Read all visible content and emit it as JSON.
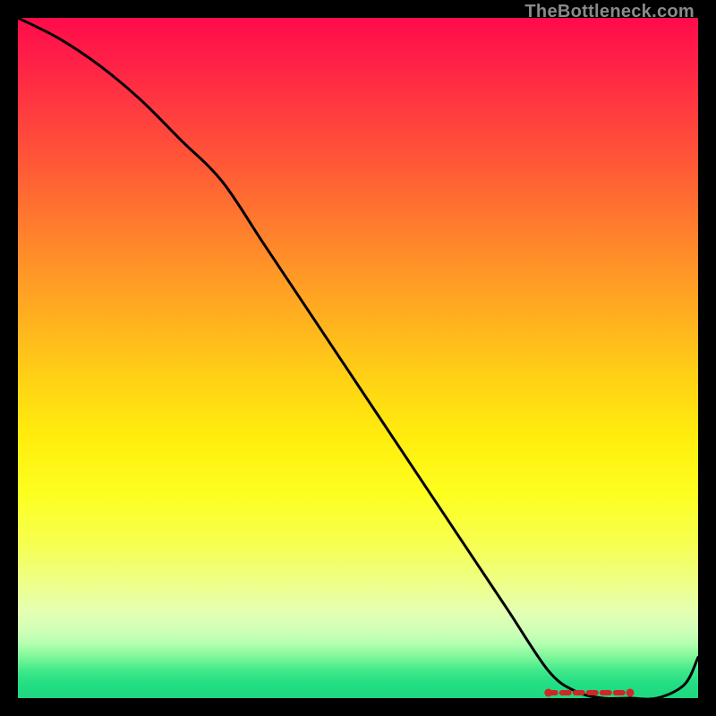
{
  "watermark": "TheBottleneck.com",
  "chart_data": {
    "type": "line",
    "title": "",
    "xlabel": "",
    "ylabel": "",
    "xlim": [
      0,
      100
    ],
    "ylim": [
      0,
      100
    ],
    "grid": false,
    "x": [
      0,
      6,
      12,
      18,
      24,
      30,
      36,
      42,
      48,
      54,
      60,
      66,
      72,
      78,
      82,
      86,
      90,
      94,
      98,
      100
    ],
    "values": [
      100,
      97,
      93,
      88,
      82,
      76,
      67,
      58,
      49,
      40,
      31,
      22,
      13,
      4,
      1,
      0,
      0,
      0,
      2,
      6
    ],
    "marker_segment": {
      "x_from": 78,
      "x_to": 90,
      "y": 0
    },
    "background": "rainbow-vertical",
    "series": [
      {
        "name": "bottleneck-curve",
        "color": "#000000"
      }
    ]
  }
}
